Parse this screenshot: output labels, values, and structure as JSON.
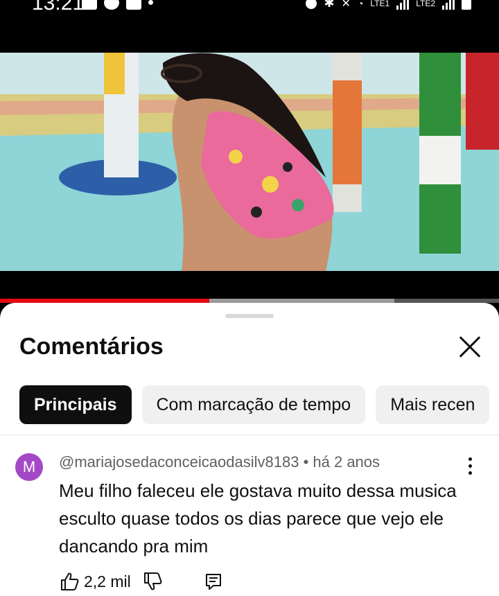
{
  "status_bar": {
    "time": "13:21",
    "left_icons": [
      "image-icon",
      "b-icon",
      "cast-icon"
    ],
    "sim1_label": "LTE1",
    "sim2_label": "LTE2",
    "right_icons": [
      "alarm-icon",
      "bluetooth-icon",
      "mute-icon",
      "wifi-icon",
      "signal-icon",
      "battery-icon"
    ]
  },
  "video": {
    "progress_fraction": 0.42,
    "buffered_fraction": 0.79,
    "colors": {
      "pool": "#8fd4d6",
      "progress": "#e50914"
    }
  },
  "comments_sheet": {
    "title": "Comentários",
    "close_icon": "close-icon",
    "chips": [
      {
        "label": "Principais",
        "active": true
      },
      {
        "label": "Com marcação de tempo",
        "active": false
      },
      {
        "label": "Mais recen",
        "active": false
      }
    ],
    "comment": {
      "avatar_letter": "M",
      "avatar_color": "#a349c7",
      "author": "@mariajosedaconceicaodasilv8183",
      "separator": "•",
      "age": "há 2 anos",
      "text": "Meu filho faleceu ele gostava muito dessa musica esculto quase todos os dias parece que vejo ele dancando pra mim",
      "like_count": "2,2 mil",
      "icons": [
        "thumbs-up-icon",
        "thumbs-down-icon",
        "reply-icon",
        "more-vertical-icon"
      ]
    }
  }
}
